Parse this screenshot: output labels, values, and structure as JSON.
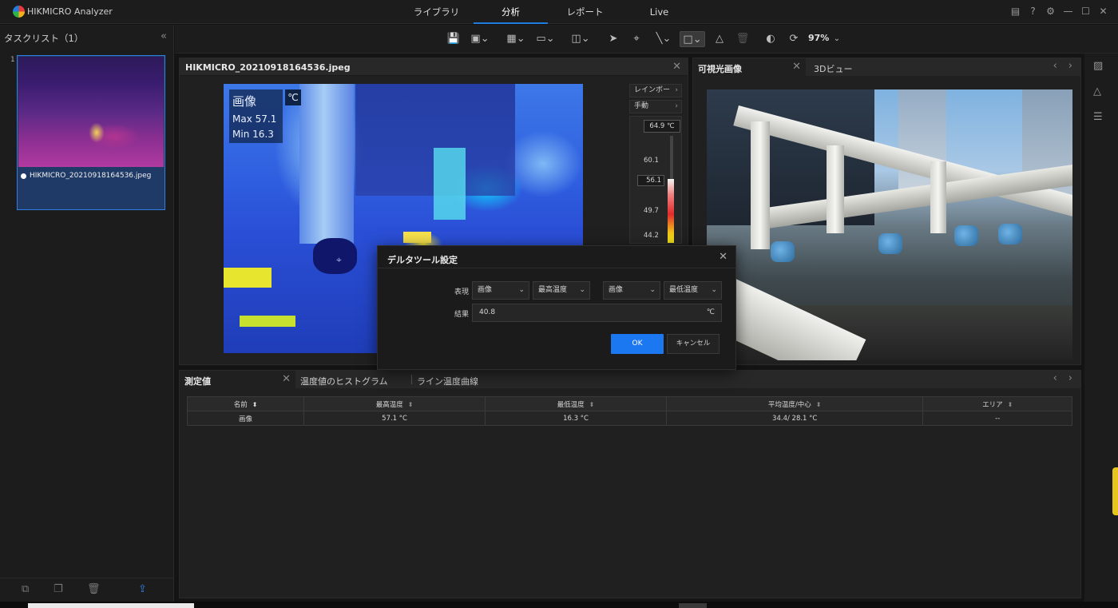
{
  "app": {
    "title": "HIKMICRO Analyzer"
  },
  "tabs": [
    {
      "label": "ライブラリ"
    },
    {
      "label": "分析",
      "active": true
    },
    {
      "label": "レポート"
    },
    {
      "label": "Live"
    }
  ],
  "sidebar": {
    "title": "タスクリスト（1）",
    "items": [
      {
        "index": "1",
        "filename": "HIKMICRO_20210918164536.jpeg"
      }
    ]
  },
  "toolbar": {
    "zoom": "97%"
  },
  "main_panel": {
    "tab_name": "HIKMICRO_20210918164536.jpeg",
    "overlay": {
      "name": "画像",
      "max": "Max 57.1",
      "min": "Min 16.3",
      "unit": "℃"
    },
    "palette_label": "レインボー",
    "mode_label": "手動",
    "scale": {
      "max": "64.9 ℃",
      "t1": "60.1",
      "current": "56.1",
      "t2": "49.7",
      "t3": "44.2"
    }
  },
  "visible_panel": {
    "tab1": "可視光画像",
    "tab2": "3Dビュー"
  },
  "bottom_panel": {
    "tabs": [
      "測定値",
      "温度値のヒストグラム",
      "ライン温度曲線"
    ],
    "columns": [
      "名前",
      "最高温度",
      "最低温度",
      "平均温度/中心",
      "エリア"
    ],
    "rows": [
      {
        "name": "画像",
        "max": "57.1 °C",
        "min": "16.3 °C",
        "avg": "34.4/ 28.1 °C",
        "area": "--"
      }
    ]
  },
  "dialog": {
    "title": "デルタツール設定",
    "expression_label": "表現",
    "result_label": "結果",
    "select1": "画像",
    "select2": "最高温度",
    "select3": "画像",
    "select4": "最低温度",
    "result_value": "40.8",
    "result_unit": "℃",
    "ok": "OK",
    "cancel": "キャンセル"
  },
  "colors": {
    "accent": "#1c78f0",
    "background": "#141414",
    "panel": "#202020"
  }
}
